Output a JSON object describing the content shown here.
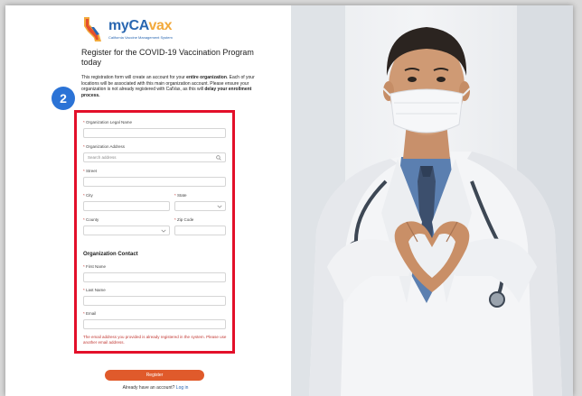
{
  "logo": {
    "name_main": "myCA",
    "name_accent": "vax",
    "subtitle": "California Vaccine Management System"
  },
  "badge": "2",
  "title": "Register for the COVID-19 Vaccination Program today",
  "intro": {
    "p1": "This registration form will create an account for your ",
    "p1_bold": "entire organization",
    "p2": ". Each of your locations will be associated with this main organization account. Please ensure your organization is not already registered with CalVax, as this will ",
    "p2_bold": "delay your enrollment process."
  },
  "form": {
    "org_legal_name_label": "Organization Legal Name",
    "org_address_label": "Organization Address",
    "search_placeholder": "Search address",
    "street_label": "Street",
    "city_label": "City",
    "state_label": "State",
    "county_label": "County",
    "zip_label": "Zip Code",
    "contact_section": "Organization Contact",
    "first_name_label": "First Name",
    "last_name_label": "Last Name",
    "email_label": "Email",
    "required_marker": "*"
  },
  "error_message": "The email address you provided is already registered in the system. Please use another email address.",
  "register_button": "Register",
  "login": {
    "prompt": "Already have an account?",
    "link": "Log in"
  },
  "colors": {
    "highlight_border": "#e3102a",
    "badge": "#2b73d6",
    "register_button": "#e05a2b",
    "brand_blue": "#2a67b1",
    "brand_orange": "#f2a93b",
    "error_text": "#c23934"
  }
}
